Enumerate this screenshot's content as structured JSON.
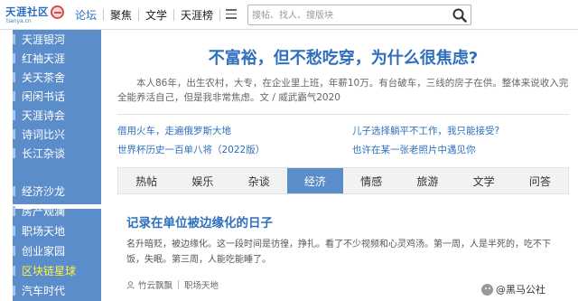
{
  "logo": {
    "name": "天涯社区",
    "domain": "tianya.cn"
  },
  "nav": {
    "items": [
      "论坛",
      "聚焦",
      "文学",
      "天涯榜"
    ],
    "active": 0
  },
  "search": {
    "placeholder": "搜帖、找人、搜版块"
  },
  "sidebar": {
    "items": [
      "天涯银河",
      "红袖天涯",
      "关天茶舍",
      "闲闲书话",
      "天涯诗会",
      "诗词比兴",
      "长江杂谈",
      "经济沙龙",
      "房产观澜",
      "职场天地",
      "创业家园",
      "区块链星球",
      "汽车时代"
    ],
    "highlighted": "区块链星球"
  },
  "headline": "不富裕，但不愁吃穿，为什么很焦虑?",
  "summary": "本人86年，出生农村，大专，在企业里上班，年薪10万。有台破车，三线的房子在供。整体来说收入完全能养活自己，但是我非常焦虑。文 / 威武霸气2020",
  "links": [
    "借用火车，走遍俄罗斯大地",
    "儿子选择躺平不工作，我只能接受?",
    "世界杯历史一百单八将（2022版）",
    "也许在某一张老照片中遇见你"
  ],
  "tabs": {
    "items": [
      "热帖",
      "娱乐",
      "杂谈",
      "经济",
      "情感",
      "旅游",
      "文学",
      "问答"
    ],
    "active": "经济"
  },
  "article": {
    "title": "记录在单位被边缘化的日子",
    "excerpt": "名升暗贬，被边缘化。这一段时间是彷徨，挣扎。看了不少视频和心灵鸡汤。第一周，人是半死的，吃不下饭，失眠。第三周，人能吃能睡了。",
    "author": "竹云飘飘",
    "board": "职场天地"
  },
  "watermark": "@黑马公社",
  "colors": {
    "accent": "#2f6fbd",
    "sidebar": "#5b8dcb",
    "highlight": "#fff23c"
  }
}
